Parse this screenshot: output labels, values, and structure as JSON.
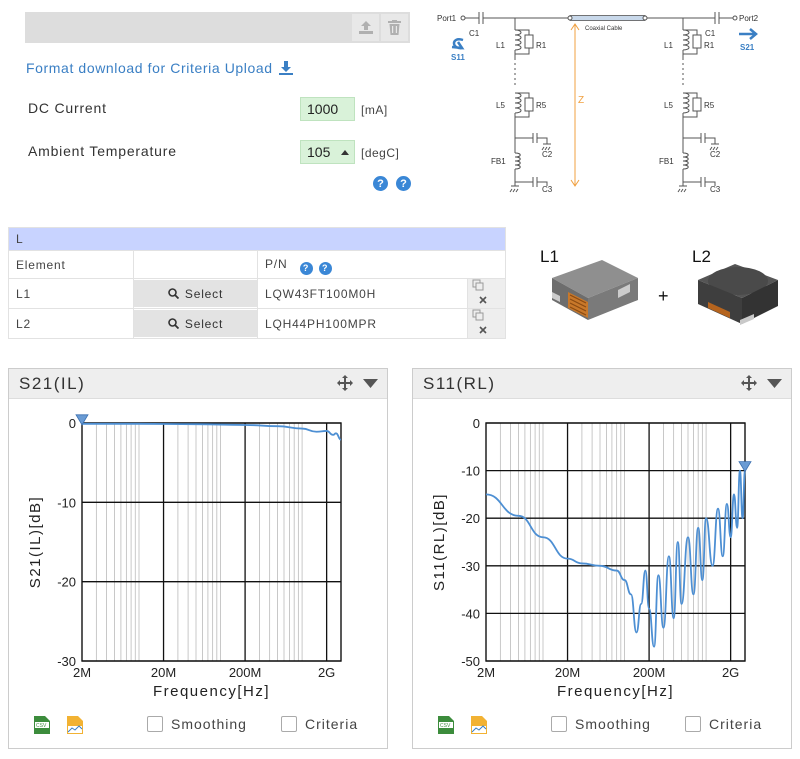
{
  "format_link": "Format download for Criteria Upload",
  "params": {
    "dc_current": {
      "label": "DC Current",
      "value": "1000",
      "unit": "[mA]"
    },
    "ambient_temp": {
      "label": "Ambient Temperature",
      "value": "105",
      "unit": "[degC]"
    }
  },
  "table": {
    "group": "L",
    "col_element": "Element",
    "col_pn": "P/N",
    "rows": [
      {
        "element": "L1",
        "select": "Select",
        "pn": "LQW43FT100M0H"
      },
      {
        "element": "L2",
        "select": "Select",
        "pn": "LQH44PH100MPR"
      }
    ]
  },
  "circuit": {
    "port1": "Port1",
    "port2": "Port2",
    "cable": "Coaxial Cable",
    "z": "Z",
    "s11": "S11",
    "s21": "S21",
    "labels": [
      "C1",
      "L1",
      "R1",
      "L5",
      "R5",
      "FB1",
      "C2",
      "C3"
    ]
  },
  "parts": {
    "l1": "L1",
    "l2": "L2",
    "plus": "+"
  },
  "charts": {
    "s21": {
      "title": "S21(IL)",
      "chart_data": {
        "type": "line",
        "xlabel": "Frequency[Hz]",
        "ylabel": "S21(IL)[dB]",
        "xscale": "log",
        "xlim": [
          2000000,
          3000000000
        ],
        "ylim": [
          -30,
          0
        ],
        "xticks": [
          "2M",
          "20M",
          "200M",
          "2G"
        ],
        "yticks": [
          "0",
          "-10",
          "-20",
          "-30"
        ],
        "series": [
          {
            "x": [
              2000000,
              10000000,
              50000000,
              200000000,
              500000000,
              1000000000,
              1500000000,
              2000000000,
              2400000000,
              2600000000,
              3000000000
            ],
            "y": [
              -0.1,
              -0.1,
              -0.15,
              -0.25,
              -0.4,
              -0.7,
              -1.1,
              -1.0,
              -1.5,
              -1.3,
              -2.1
            ]
          }
        ]
      }
    },
    "s11": {
      "title": "S11(RL)",
      "chart_data": {
        "type": "line",
        "xlabel": "Frequency[Hz]",
        "ylabel": "S11(RL)[dB]",
        "xscale": "log",
        "xlim": [
          2000000,
          3000000000
        ],
        "ylim": [
          -50,
          0
        ],
        "xticks": [
          "2M",
          "20M",
          "200M",
          "2G"
        ],
        "yticks": [
          "0",
          "-10",
          "-20",
          "-30",
          "-40",
          "-50"
        ],
        "series": [
          {
            "x": [
              2000000,
              5000000,
              10000000,
              20000000,
              30000000,
              50000000,
              80000000,
              100000000,
              120000000,
              140000000,
              160000000,
              180000000,
              200000000,
              230000000,
              260000000,
              300000000,
              350000000,
              400000000,
              450000000,
              500000000,
              600000000,
              700000000,
              800000000,
              900000000,
              1000000000,
              1200000000,
              1400000000,
              1600000000,
              1800000000,
              2000000000,
              2200000000,
              2400000000,
              2600000000,
              2800000000,
              3000000000
            ],
            "y": [
              -15,
              -19.5,
              -24,
              -28.5,
              -29.5,
              -30,
              -31,
              -33,
              -36,
              -44,
              -38,
              -31,
              -39,
              -47,
              -32,
              -43,
              -28,
              -41,
              -25,
              -38,
              -24,
              -36,
              -22,
              -33,
              -20,
              -30,
              -18,
              -28,
              -17,
              -24,
              -15,
              -22,
              -10,
              -20,
              -10
            ]
          }
        ]
      }
    },
    "smoothing": "Smoothing",
    "criteria": "Criteria"
  },
  "colors": {
    "curve": "#4d8fd3",
    "table_header": "#c8d3ff",
    "input_bg": "#d9f2d9",
    "link": "#3a7fc4"
  }
}
